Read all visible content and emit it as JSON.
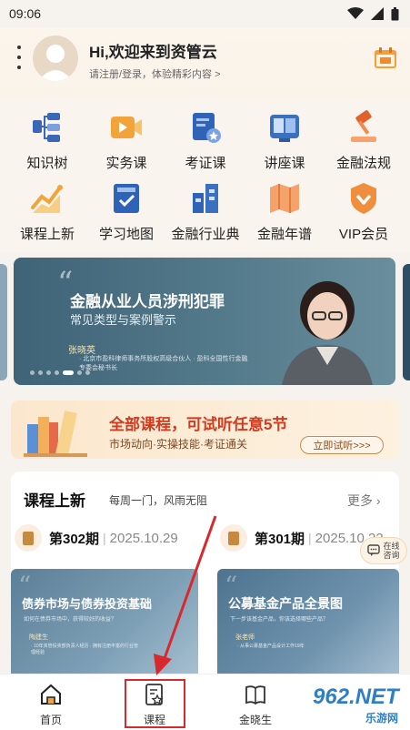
{
  "status_bar": {
    "time": "09:06"
  },
  "header": {
    "greeting": "Hi,欢迎来到资管云",
    "subtitle": "请注册/登录，体验精彩内容 >"
  },
  "grid": {
    "items": [
      {
        "label": "知识树",
        "icon": "knowledge-tree-icon"
      },
      {
        "label": "实务课",
        "icon": "video-play-icon"
      },
      {
        "label": "考证课",
        "icon": "certificate-icon"
      },
      {
        "label": "讲座课",
        "icon": "lecture-book-icon"
      },
      {
        "label": "金融法规",
        "icon": "gavel-icon"
      },
      {
        "label": "课程上新",
        "icon": "trend-chart-icon"
      },
      {
        "label": "学习地图",
        "icon": "study-map-icon"
      },
      {
        "label": "金融行业典",
        "icon": "industry-building-icon"
      },
      {
        "label": "金融年谱",
        "icon": "yearbook-map-icon"
      },
      {
        "label": "VIP会员",
        "icon": "vip-badge-icon"
      }
    ]
  },
  "banner": {
    "title": "金融从业人员涉刑犯罪",
    "subtitle": "常见类型与案例警示",
    "speaker": "张晓英",
    "desc": "· 北京市盈科律师事务所股权高级合伙人 · 盈科全国性行金融专委会秘书长"
  },
  "promo": {
    "title": "全部课程，可试听任意5节",
    "subtitle": "市场动向·实操技能·考证通关",
    "button": "立即试听>>>"
  },
  "section": {
    "title": "课程上新",
    "subtitle": "每周一门，风雨无阻",
    "more": "更多 ›",
    "issues": [
      {
        "number": "第302期",
        "date": "2025.10.29"
      },
      {
        "number": "第301期",
        "date": "2025.10.22"
      }
    ],
    "courses": [
      {
        "title": "债券市场与债券投资基础",
        "sub": "如何在债券市场中，获得较好的收益？",
        "speaker": "陶建生",
        "desc": "· 10年资管投资部负责人经历 · 拥有注册丰富的行业管理经验"
      },
      {
        "title": "公募基金产品全景图",
        "sub": "下一步该基金产品，你该选择哪些产品？",
        "speaker": "张老师",
        "desc": "· 从事公募基金产品设计工作19年"
      }
    ]
  },
  "float_consult": {
    "text": "在线咨询",
    "line1": "在线",
    "line2": "咨询"
  },
  "tabbar": {
    "tabs": [
      {
        "label": "首页",
        "icon": "home-icon"
      },
      {
        "label": "课程",
        "icon": "course-icon"
      },
      {
        "label": "金晓生",
        "icon": "book-icon"
      }
    ]
  },
  "watermark": {
    "brand": "962.NET",
    "sub": "乐游网"
  },
  "colors": {
    "accent_red": "#d8292c",
    "promo_red": "#d23a1f",
    "banner_blue": "#3f6377"
  }
}
